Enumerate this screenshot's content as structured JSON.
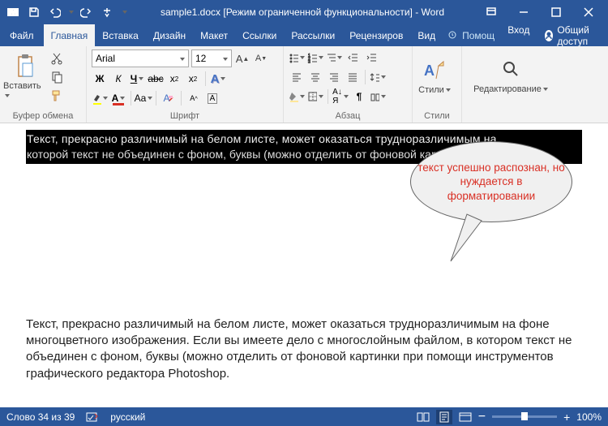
{
  "title": "sample1.docx [Режим ограниченной функциональности] - Word",
  "qat": {
    "save": "save",
    "undo": "undo",
    "redo": "redo",
    "touch": "touch-mode"
  },
  "tabs": {
    "file": "Файл",
    "home": "Главная",
    "insert": "Вставка",
    "design": "Дизайн",
    "layout": "Макет",
    "references": "Ссылки",
    "mailings": "Рассылки",
    "review": "Рецензиров",
    "view": "Вид"
  },
  "help_placeholder": "Помощ",
  "signin": "Вход",
  "share": "Общий доступ",
  "ribbon": {
    "clipboard": {
      "paste": "Вставить",
      "label": "Буфер обмена"
    },
    "font": {
      "family": "Arial",
      "size": "12",
      "label": "Шрифт"
    },
    "paragraph": {
      "label": "Абзац"
    },
    "styles": {
      "btn": "Стили",
      "label": "Стили"
    },
    "editing": {
      "btn": "Редактирование"
    }
  },
  "doc": {
    "corrupt_line1": "Текст, прекрасно различимый на белом листе, может оказаться трудноразличимым на",
    "corrupt_line2": "которой текст не объединен с фоном, буквы (можно отделить от фоновой картинки при",
    "corrupt_word": "редактора",
    "callout": "текст успешно распознан, но нуждается в форматировании",
    "body": "Текст, прекрасно различимый на белом листе, может оказаться трудноразличимым на фоне многоцветного изображения. Если вы имеете дело с многослойным файлом, в котором текст не объединен с фоном, буквы (можно отделить от фоновой картинки при помощи инструментов графического редактора Photoshop."
  },
  "status": {
    "words": "Слово 34 из 39",
    "lang": "русский",
    "zoom": "100%"
  }
}
